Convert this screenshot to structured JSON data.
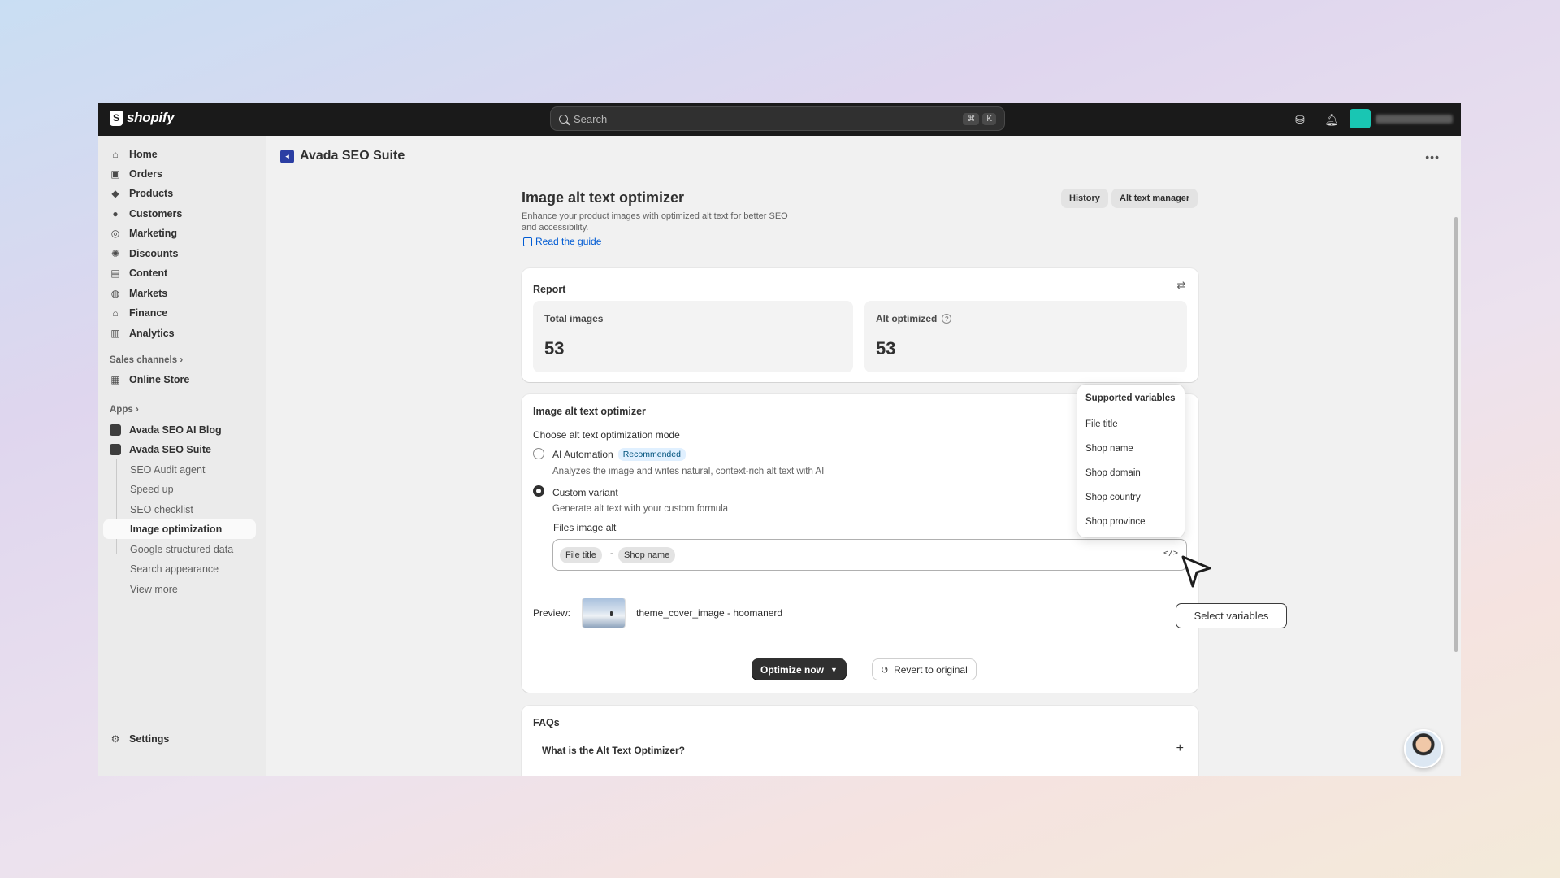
{
  "topbar": {
    "logo_text": "shopify",
    "search_placeholder": "Search",
    "shortcut_keys": [
      "⌘",
      "K"
    ]
  },
  "sidebar": {
    "main_items": [
      {
        "label": "Home",
        "icon": "home-icon"
      },
      {
        "label": "Orders",
        "icon": "inbox-icon"
      },
      {
        "label": "Products",
        "icon": "tag-icon"
      },
      {
        "label": "Customers",
        "icon": "person-icon"
      },
      {
        "label": "Marketing",
        "icon": "target-icon"
      },
      {
        "label": "Discounts",
        "icon": "discount-icon"
      },
      {
        "label": "Content",
        "icon": "content-icon"
      },
      {
        "label": "Markets",
        "icon": "globe-icon"
      },
      {
        "label": "Finance",
        "icon": "bank-icon"
      },
      {
        "label": "Analytics",
        "icon": "chart-icon"
      }
    ],
    "sales_channels_label": "Sales channels",
    "online_store": "Online Store",
    "apps_label": "Apps",
    "apps": [
      "Avada SEO AI Blog",
      "Avada SEO Suite"
    ],
    "sub_items": [
      "SEO Audit agent",
      "Speed up",
      "SEO checklist",
      "Image optimization",
      "Google structured data",
      "Search appearance",
      "View more"
    ],
    "active_sub": "Image optimization",
    "settings": "Settings"
  },
  "page": {
    "app_name": "Avada SEO Suite",
    "title": "Image alt text optimizer",
    "subtitle": "Enhance your product images with optimized alt text for better SEO and accessibility.",
    "guide_link": "Read the guide",
    "history_button": "History",
    "alt_manager_button": "Alt text manager"
  },
  "report": {
    "title": "Report",
    "total_images_label": "Total images",
    "total_images_value": "53",
    "alt_optimized_label": "Alt optimized",
    "alt_optimized_value": "53"
  },
  "optimizer": {
    "title": "Image alt text optimizer",
    "mode_label": "Choose alt text optimization mode",
    "ai_option": "AI Automation",
    "ai_badge": "Recommended",
    "ai_desc": "Analyzes the image and writes natural, context-rich alt text with AI",
    "custom_option": "Custom variant",
    "custom_desc": "Generate alt text with your custom formula",
    "selected_mode": "Custom variant",
    "field_label": "Files image alt",
    "formula_tags": [
      "File title",
      "Shop name"
    ],
    "separator": "-",
    "preview_label": "Preview:",
    "preview_text": "theme_cover_image - hoomanerd",
    "optimize_button": "Optimize now",
    "revert_button": "Revert to original"
  },
  "variables_popover": {
    "title": "Supported variables",
    "items": [
      "File title",
      "Shop name",
      "Shop domain",
      "Shop country",
      "Shop province"
    ]
  },
  "tooltip": "Select variables",
  "faqs": {
    "title": "FAQs",
    "items": [
      "What is the Alt Text Optimizer?"
    ]
  },
  "colors": {
    "topbar": "#1a1a1a",
    "link": "#005bd3",
    "badge_bg": "#e0f0ff",
    "primary_button": "#303030"
  }
}
